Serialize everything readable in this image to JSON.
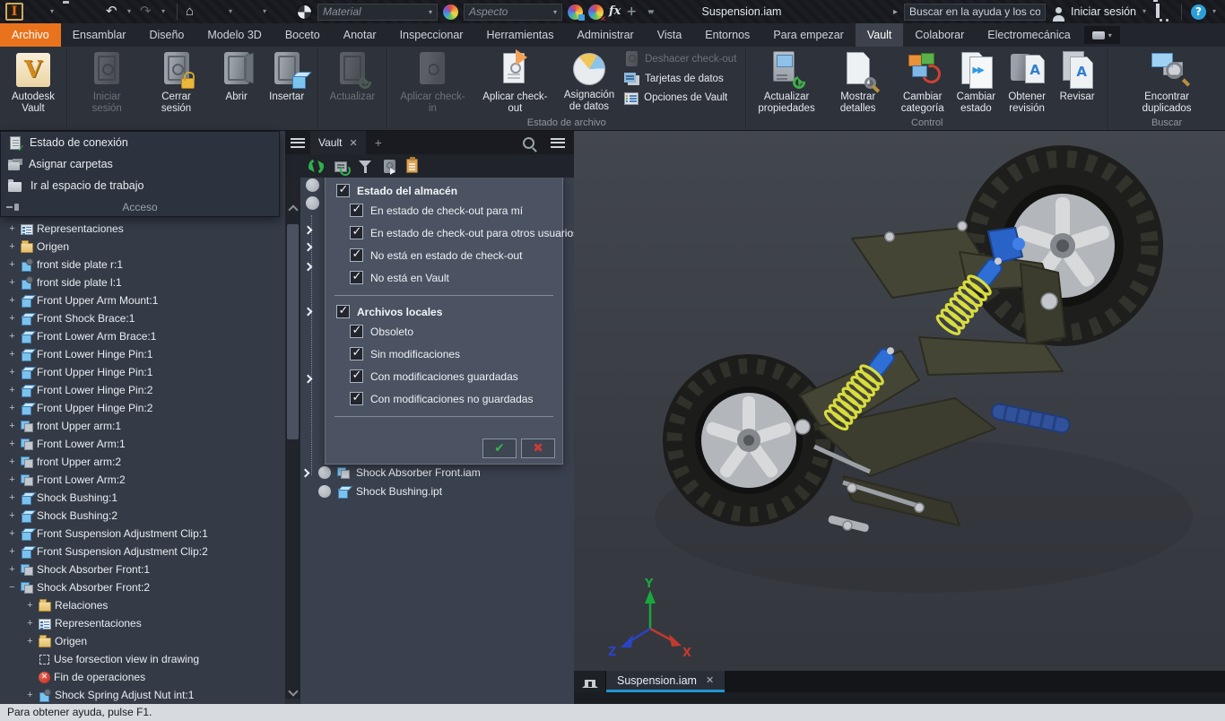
{
  "colors": {
    "accent": "#e9731d",
    "tab_underline": "#2095d5",
    "ok_green": "#35b24a",
    "cancel_red": "#cc3a3a",
    "spring_yellow": "#d8dc3e",
    "shock_blue": "#2e6fd6"
  },
  "titlebar": {
    "document_title": "Suspension.iam",
    "material_dropdown": "Material",
    "aspect_dropdown": "Aspecto",
    "search_placeholder": "Buscar en la ayuda y los comanc",
    "sign_in_label": "Iniciar sesión",
    "help_glyph": "?"
  },
  "tabs": [
    {
      "label": "Archivo",
      "cls": "file"
    },
    {
      "label": "Ensamblar"
    },
    {
      "label": "Diseño"
    },
    {
      "label": "Modelo 3D"
    },
    {
      "label": "Boceto"
    },
    {
      "label": "Anotar"
    },
    {
      "label": "Inspeccionar"
    },
    {
      "label": "Herramientas"
    },
    {
      "label": "Administrar"
    },
    {
      "label": "Vista"
    },
    {
      "label": "Entornos"
    },
    {
      "label": "Para empezar"
    },
    {
      "label": "Vault",
      "cls": "active"
    },
    {
      "label": "Colaborar"
    },
    {
      "label": "Electromecánica"
    }
  ],
  "ribbon": {
    "groups": [
      {
        "label": "",
        "buttons": [
          {
            "label": "Autodesk\nVault",
            "icon": "vaultlogo"
          }
        ]
      },
      {
        "label": "",
        "buttons": [
          {
            "label": "Iniciar sesión",
            "icon": "safe",
            "state": "disabled"
          },
          {
            "label": "Cerrar sesión",
            "icon": "safelock"
          },
          {
            "label": "Abrir",
            "icon": "safeopen"
          },
          {
            "label": "Insertar",
            "icon": "safecube"
          }
        ]
      },
      {
        "label": "",
        "buttons": [
          {
            "label": "Actualizar",
            "icon": "saferefresh",
            "state": "disabled"
          }
        ]
      },
      {
        "label": "Estado de archivo",
        "buttons": [
          {
            "label": "Aplicar check-in",
            "icon": "checkin",
            "state": "disabled"
          },
          {
            "label": "Aplicar check-out",
            "icon": "checkout"
          },
          {
            "label": "Asignación\nde datos",
            "icon": "pie"
          }
        ],
        "smalls": [
          {
            "label": "Deshacer check-out",
            "icon": "s-undo",
            "state": "disabled"
          },
          {
            "label": "Tarjetas de datos",
            "icon": "s-cards"
          },
          {
            "label": "Opciones de Vault",
            "icon": "s-options"
          }
        ]
      },
      {
        "label": "Control",
        "buttons": [
          {
            "label": "Actualizar\npropiedades",
            "icon": "props"
          },
          {
            "label": "Mostrar detalles",
            "icon": "details"
          },
          {
            "label": "Cambiar\ncategoría",
            "icon": "category"
          },
          {
            "label": "Cambiar\nestado",
            "icon": "state"
          },
          {
            "label": "Obtener\nrevisión",
            "icon": "revision"
          },
          {
            "label": "Revisar",
            "icon": "review"
          }
        ]
      },
      {
        "label": "Buscar",
        "buttons": [
          {
            "label": "Encontrar duplicados",
            "icon": "duplicates"
          }
        ]
      }
    ]
  },
  "access_panel": {
    "items": [
      {
        "label": "Estado de conexión",
        "icon": "a-status"
      },
      {
        "label": "Asignar carpetas",
        "icon": "a-folders"
      },
      {
        "label": "Ir al espacio de trabajo",
        "icon": "a-workspace"
      }
    ],
    "footer": "Acceso"
  },
  "model_tree": {
    "items": [
      {
        "exp": "+",
        "icon": "rep",
        "label": "Representaciones"
      },
      {
        "exp": "+",
        "icon": "folder",
        "label": "Origen"
      },
      {
        "exp": "+",
        "icon": "pinpart",
        "label": "front side plate r:1"
      },
      {
        "exp": "+",
        "icon": "pinpart",
        "label": "front side plate l:1"
      },
      {
        "exp": "+",
        "icon": "part",
        "label": "Front Upper Arm Mount:1"
      },
      {
        "exp": "+",
        "icon": "part",
        "label": "Front Shock Brace:1"
      },
      {
        "exp": "+",
        "icon": "part",
        "label": "Front Lower Arm Brace:1"
      },
      {
        "exp": "+",
        "icon": "part",
        "label": "Front Lower Hinge Pin:1"
      },
      {
        "exp": "+",
        "icon": "part",
        "label": "Front Upper Hinge Pin:1"
      },
      {
        "exp": "+",
        "icon": "part",
        "label": "Front Lower Hinge Pin:2"
      },
      {
        "exp": "+",
        "icon": "part",
        "label": "Front Upper Hinge Pin:2"
      },
      {
        "exp": "+",
        "icon": "asm",
        "label": "front Upper arm:1"
      },
      {
        "exp": "+",
        "icon": "asm",
        "label": "Front Lower Arm:1"
      },
      {
        "exp": "+",
        "icon": "asm",
        "label": "front Upper arm:2"
      },
      {
        "exp": "+",
        "icon": "asm",
        "label": "Front Lower Arm:2"
      },
      {
        "exp": "+",
        "icon": "part",
        "label": "Shock Bushing:1"
      },
      {
        "exp": "+",
        "icon": "part",
        "label": "Shock Bushing:2"
      },
      {
        "exp": "+",
        "icon": "part",
        "label": "Front Suspension Adjustment Clip:1"
      },
      {
        "exp": "+",
        "icon": "part",
        "label": "Front Suspension Adjustment Clip:2"
      },
      {
        "exp": "+",
        "icon": "asm",
        "label": "Shock Absorber Front:1"
      },
      {
        "exp": "−",
        "icon": "asm",
        "label": "Shock Absorber Front:2"
      },
      {
        "exp": "+",
        "icon": "folder",
        "label": "Relaciones",
        "ind": "ind1"
      },
      {
        "exp": "+",
        "icon": "rep",
        "label": "Representaciones",
        "ind": "ind1"
      },
      {
        "exp": "+",
        "icon": "folder",
        "label": "Origen",
        "ind": "ind1"
      },
      {
        "exp": "",
        "icon": "section",
        "label": "Use forsection view in drawing",
        "ind": "ind1"
      },
      {
        "exp": "",
        "icon": "eof",
        "label": "Fin de operaciones",
        "ind": "ind1"
      },
      {
        "exp": "+",
        "icon": "pinpart",
        "label": "Shock Spring Adjust Nut int:1",
        "ind": "ind1"
      }
    ]
  },
  "vault": {
    "tab_label": "Vault",
    "filter": {
      "sections": [
        {
          "label": "Estado del almacén",
          "items": [
            "En estado de check-out para mí",
            "En estado de check-out para otros usuarios",
            "No está en estado de check-out",
            "No está en Vault"
          ]
        },
        {
          "label": "Archivos locales",
          "items": [
            "Obsoleto",
            "Sin modificaciones",
            "Con modificaciones guardadas",
            "Con modificaciones no guardadas"
          ]
        }
      ]
    },
    "files": [
      {
        "icon": "asm",
        "label": "Shock Absorber Front.iam"
      },
      {
        "icon": "part",
        "label": "Shock Bushing.ipt"
      }
    ]
  },
  "viewport": {
    "doc_tab": "Suspension.iam",
    "axis_x": "X",
    "axis_y": "Y",
    "axis_z": "Z"
  },
  "statusbar": {
    "text": "Para obtener ayuda, pulse F1."
  }
}
